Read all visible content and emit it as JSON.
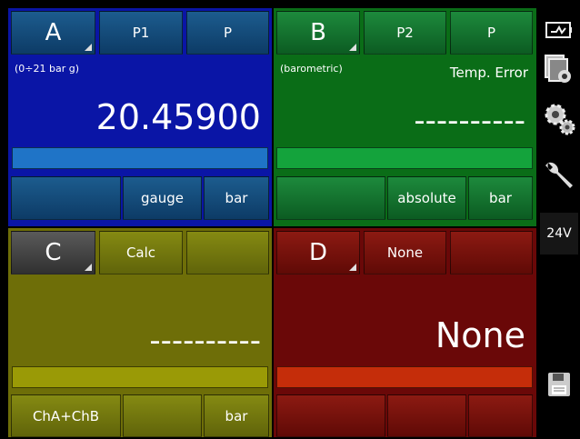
{
  "panels": {
    "A": {
      "channel": "A",
      "port": "P1",
      "sub": "P",
      "range": "(0÷21 bar g)",
      "value": "20.45900",
      "mode_blank": "",
      "mode": "gauge",
      "unit": "bar"
    },
    "B": {
      "channel": "B",
      "port": "P2",
      "sub": "P",
      "range": "(barometric)",
      "status": "Temp. Error",
      "value": "----------",
      "mode_blank": "",
      "mode": "absolute",
      "unit": "bar"
    },
    "C": {
      "channel": "C",
      "port": "Calc",
      "sub": "",
      "value": "----------",
      "formula": "ChA+ChB",
      "mode": "",
      "unit": "bar"
    },
    "D": {
      "channel": "D",
      "port": "None",
      "sub": "",
      "value": "None",
      "formula": "",
      "mode": "",
      "unit": ""
    }
  },
  "sidebar": {
    "voltage": "24V",
    "icons": [
      "power-supply-icon",
      "screen-settings-icon",
      "gears-settings-icon",
      "wrench-icon",
      "save-icon"
    ]
  },
  "colors": {
    "panelA": "#0a15a6",
    "panelB": "#0a6d17",
    "panelC": "#6e6e08",
    "panelD": "#6a0808"
  }
}
